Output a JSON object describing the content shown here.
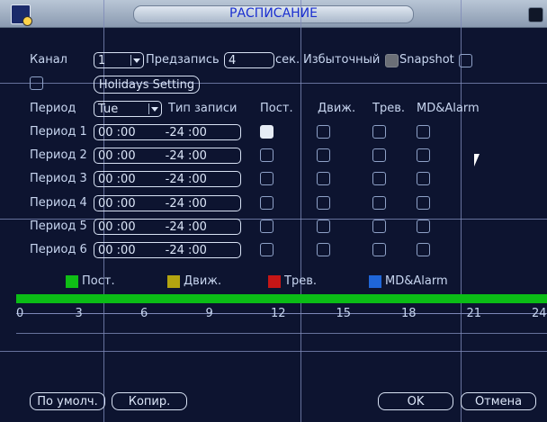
{
  "window": {
    "title": "РАСПИСАНИЕ"
  },
  "top": {
    "channel_label": "Канал",
    "channel_value": "1",
    "prerecord_label": "Предзапись",
    "prerecord_value": "4",
    "sec_label": "сек.",
    "redundant_label": "Избыточный",
    "snapshot_label": "Snapshot",
    "holidays_button": "Holidays Setting"
  },
  "header": {
    "period_label": "Период",
    "day_value": "Tue",
    "rec_type_label": "Тип записи",
    "col_regular": "Пост.",
    "col_motion": "Движ.",
    "col_alarm": "Трев.",
    "col_mdalarm": "MD&Alarm"
  },
  "periods": [
    {
      "label": "Период 1",
      "range": "00 :00        -24 :00",
      "regular": true,
      "motion": false,
      "alarm": false,
      "mdalarm": false
    },
    {
      "label": "Период 2",
      "range": "00 :00        -24 :00",
      "regular": false,
      "motion": false,
      "alarm": false,
      "mdalarm": false
    },
    {
      "label": "Период 3",
      "range": "00 :00        -24 :00",
      "regular": false,
      "motion": false,
      "alarm": false,
      "mdalarm": false
    },
    {
      "label": "Период 4",
      "range": "00 :00        -24 :00",
      "regular": false,
      "motion": false,
      "alarm": false,
      "mdalarm": false
    },
    {
      "label": "Период 5",
      "range": "00 :00        -24 :00",
      "regular": false,
      "motion": false,
      "alarm": false,
      "mdalarm": false
    },
    {
      "label": "Период 6",
      "range": "00 :00        -24 :00",
      "regular": false,
      "motion": false,
      "alarm": false,
      "mdalarm": false
    }
  ],
  "legend": [
    {
      "label": "Пост.",
      "color": "#0fbe16"
    },
    {
      "label": "Движ.",
      "color": "#b3a410"
    },
    {
      "label": "Трев.",
      "color": "#c61616"
    },
    {
      "label": "MD&Alarm",
      "color": "#1f66d8"
    }
  ],
  "timeline": {
    "ticks": [
      "0",
      "3",
      "6",
      "9",
      "12",
      "15",
      "18",
      "21",
      "24"
    ],
    "bar_color": "#0bbd16",
    "coverage_hours": [
      0,
      24
    ]
  },
  "buttons": {
    "default": "По умолч.",
    "copy": "Копир.",
    "ok": "OK",
    "cancel": "Отмена"
  }
}
